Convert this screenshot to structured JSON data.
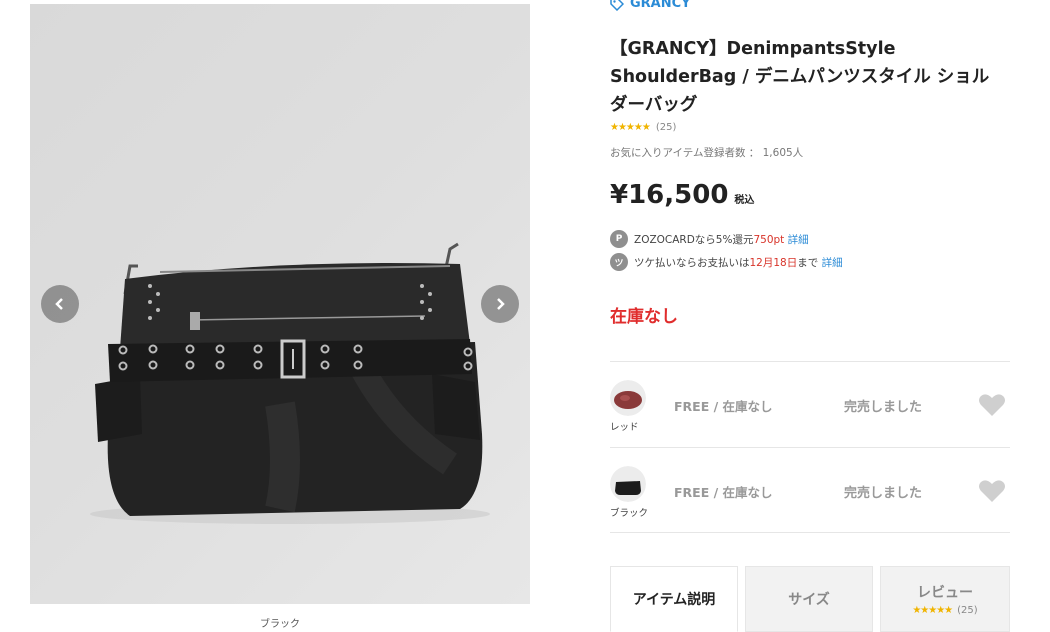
{
  "gallery": {
    "caption": "ブラック",
    "prev_icon": "chevron-left-icon",
    "next_icon": "chevron-right-icon"
  },
  "product": {
    "brand": "GRANCY",
    "brand_icon": "tag-icon",
    "title": "【GRANCY】DenimpantsStyle ShoulderBag / デニムパンツスタイル ショルダーバッグ",
    "rating_stars": "★★★★★",
    "rating_count": "(25)",
    "favorites": "お気に入りアイテム登録者数 ： 1,605人",
    "price": "¥16,500",
    "tax_label": "税込",
    "zozocard": {
      "icon": "P",
      "text_prefix": "ZOZOCARDなら5%還元",
      "points": "750pt",
      "link": "詳細"
    },
    "tsuke": {
      "icon": "ツ",
      "text_prefix": "ツケ払いならお支払いは",
      "date": "12月18日",
      "text_suffix": "まで",
      "link": "詳細"
    },
    "stock_status": "在庫なし"
  },
  "variants": [
    {
      "color": "レッド",
      "size_stock": "FREE / 在庫なし",
      "status": "完売しました",
      "swatch": "#8a3a3a"
    },
    {
      "color": "ブラック",
      "size_stock": "FREE / 在庫なし",
      "status": "完売しました",
      "swatch": "#1c1c1c"
    }
  ],
  "tabs": {
    "description": "アイテム説明",
    "size": "サイズ",
    "review": "レビュー",
    "review_stars": "★★★★★",
    "review_count": "(25)"
  },
  "colors": {
    "link": "#2b8bd6",
    "sold_out_red": "#e02d2d",
    "star": "#f0b400"
  }
}
